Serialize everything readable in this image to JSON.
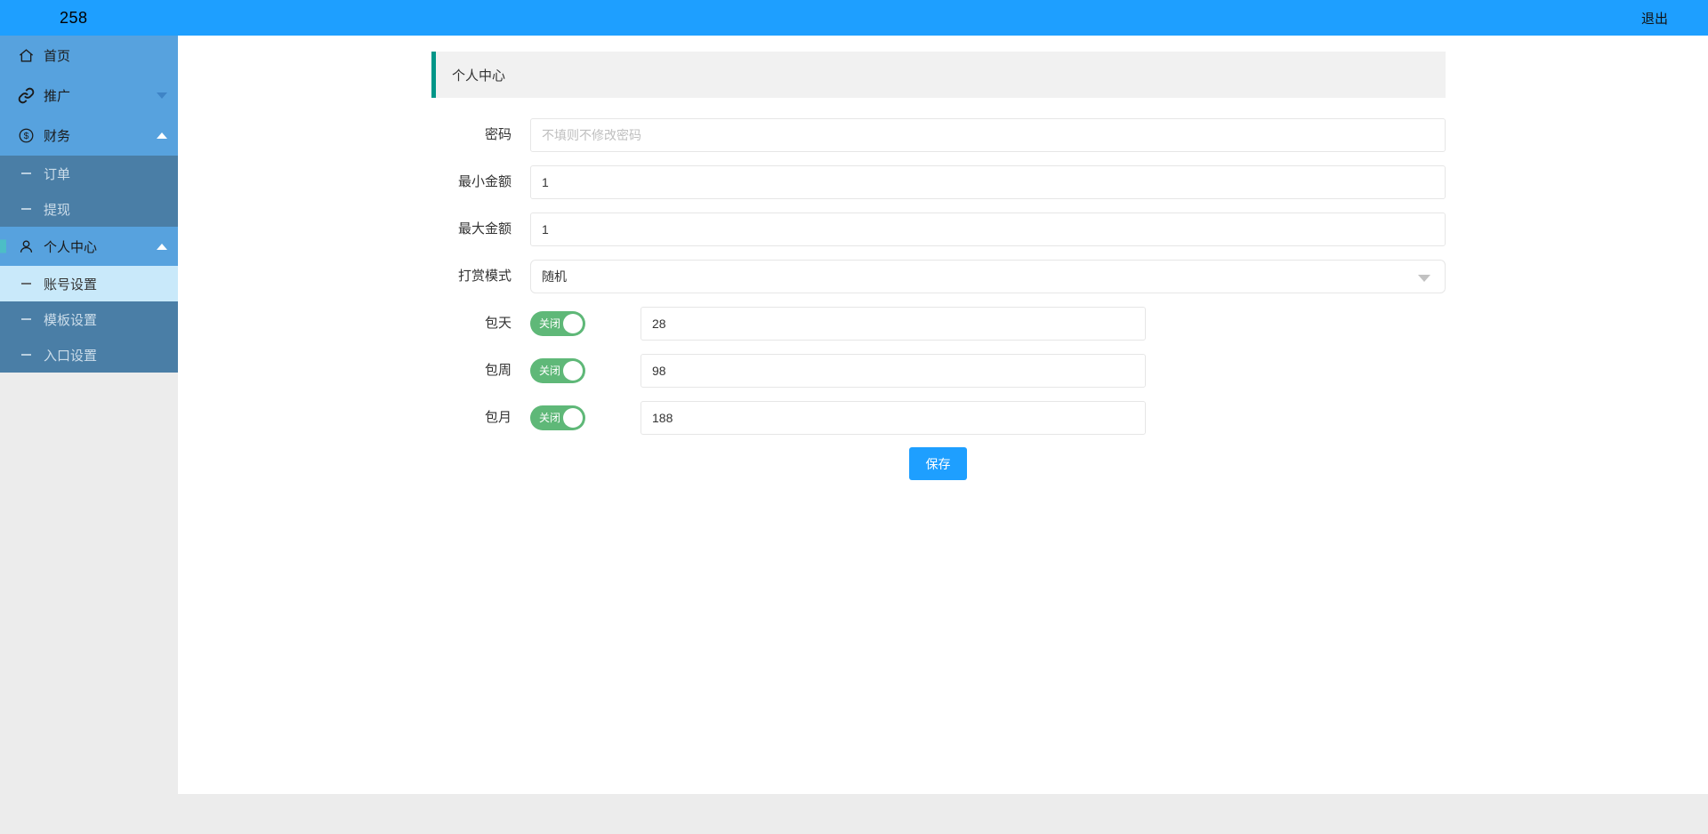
{
  "topbar": {
    "brand": "258",
    "logout_label": "退出"
  },
  "sidebar": {
    "items": [
      {
        "label": "首页",
        "icon": "home-icon"
      },
      {
        "label": "推广",
        "icon": "link-icon",
        "state": "collapsed"
      },
      {
        "label": "财务",
        "icon": "money-icon",
        "state": "expanded",
        "children": [
          "订单",
          "提现"
        ]
      },
      {
        "label": "个人中心",
        "icon": "user-icon",
        "state": "expanded",
        "children": [
          "账号设置",
          "模板设置",
          "入口设置"
        ],
        "active_child": "账号设置"
      }
    ]
  },
  "panel": {
    "title": "个人中心"
  },
  "form": {
    "password": {
      "label": "密码",
      "placeholder": "不填则不修改密码",
      "value": ""
    },
    "min_amount": {
      "label": "最小金额",
      "value": "1"
    },
    "max_amount": {
      "label": "最大金额",
      "value": "1"
    },
    "reward_mode": {
      "label": "打赏模式",
      "value": "随机"
    },
    "daily": {
      "label": "包天",
      "toggle_label": "关闭",
      "toggle_state": "on",
      "value": "28"
    },
    "weekly": {
      "label": "包周",
      "toggle_label": "关闭",
      "toggle_state": "on",
      "value": "98"
    },
    "monthly": {
      "label": "包月",
      "toggle_label": "关闭",
      "toggle_state": "on",
      "value": "188"
    },
    "save_label": "保存"
  },
  "colors": {
    "c-topbar": "#1E9FFF",
    "c-sidebar": "#57A2DE",
    "c-submenu": "#4A7EA6",
    "c-selected": "#C9E9FA",
    "c-indicator": "#4CBEC6",
    "c-teal": "#009688",
    "c-green": "#5FB878",
    "c-blue": "#1E9FFF",
    "c-header-gray": "#F1F1F1",
    "c-page-gray": "#ECECEC"
  }
}
